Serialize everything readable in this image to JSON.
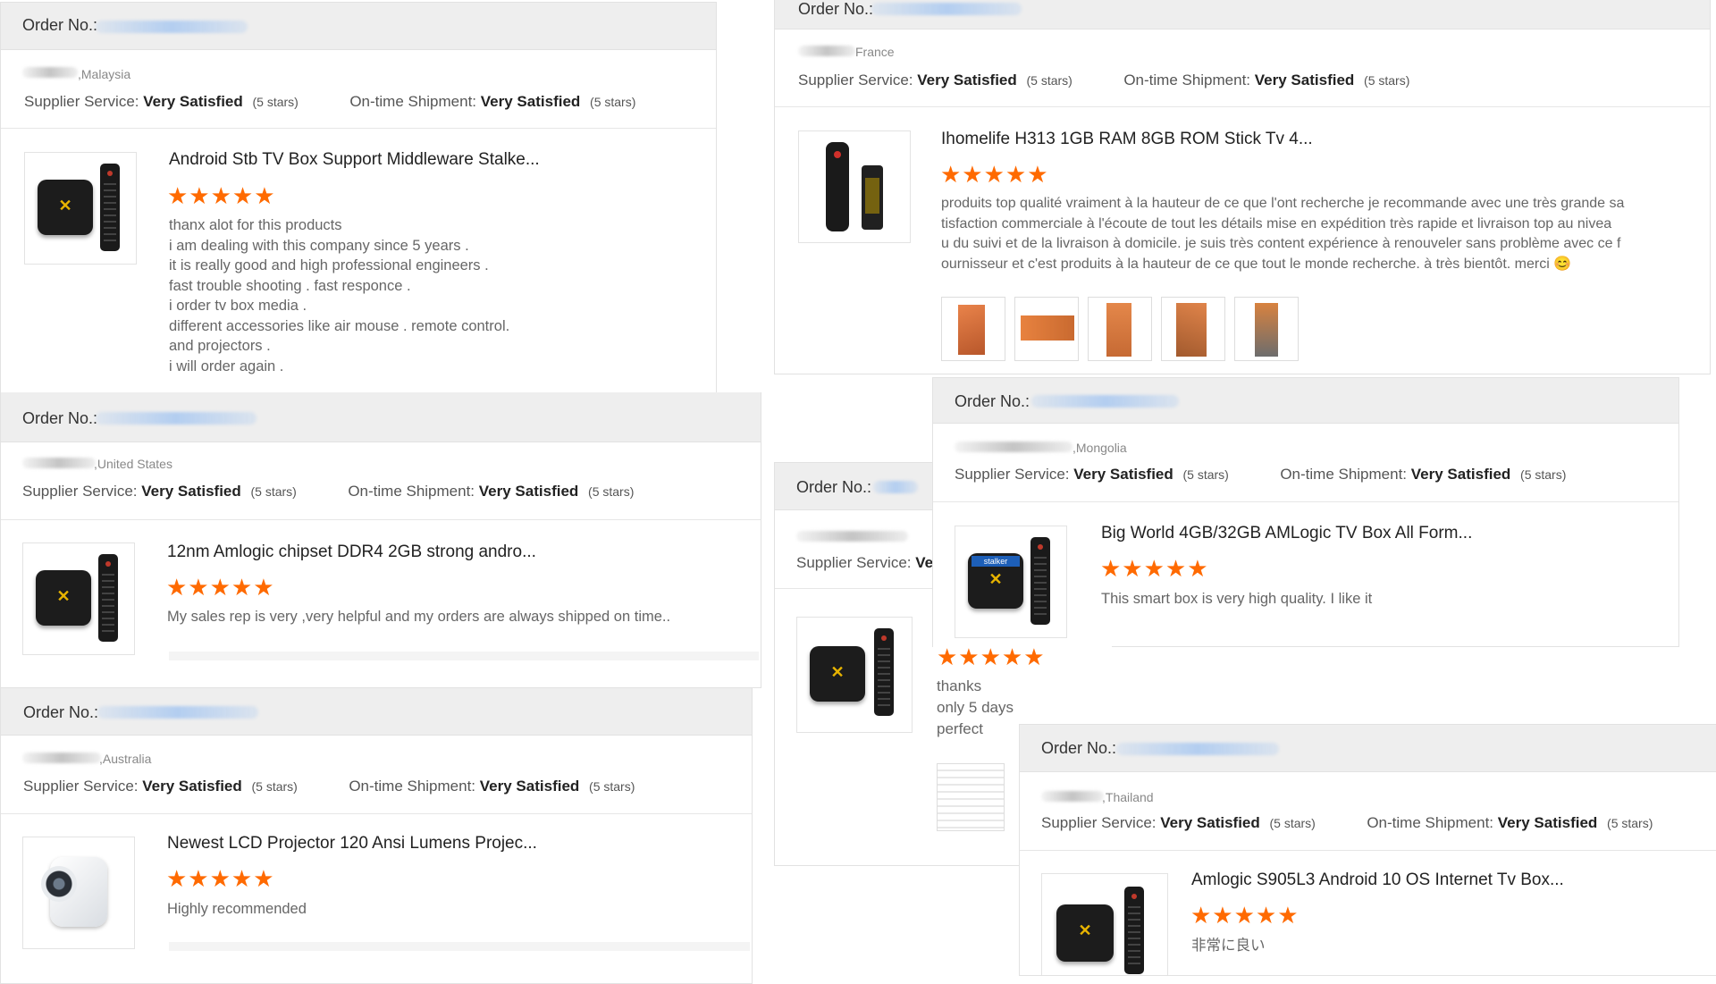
{
  "labels": {
    "order_no": "Order No.:",
    "supplier_service": "Supplier Service:",
    "on_time_shipment": "On-time Shipment:",
    "very_satisfied": "Very Satisfied",
    "five_stars": "(5 stars)",
    "supplier_service_cut": "Supplier Service:",
    "very_cut": "Ve"
  },
  "rating_stars": "★★★★★",
  "accent_color": "#ff6a00",
  "reviews": [
    {
      "country": ",Malaysia",
      "product_title": "Android Stb TV Box Support Middleware Stalke...",
      "rating": 5,
      "text_lines": [
        "thanx alot for this products",
        "i am dealing with this company since 5 years .",
        "it is really good and high professional engineers .",
        "fast trouble shooting . fast responce .",
        "i order tv box media .",
        "different accessories like air mouse . remote control.",
        "and projectors .",
        "i will order again ."
      ]
    },
    {
      "country": ",United States",
      "product_title": "12nm Amlogic chipset DDR4 2GB strong andro...",
      "rating": 5,
      "text_lines": [
        "My sales rep is very ,very helpful and my orders are always shipped on time.."
      ]
    },
    {
      "country": ",Australia",
      "product_title": "Newest LCD Projector 120 Ansi Lumens Projec...",
      "rating": 5,
      "text_lines": [
        "Highly recommended"
      ]
    },
    {
      "country": "France",
      "product_title": "Ihomelife H313 1GB RAM 8GB ROM Stick Tv 4...",
      "rating": 5,
      "text_lines": [
        "produits top qualité vraiment à la hauteur de ce que l'ont recherche je recommande avec une très grande sa",
        "tisfaction commerciale à l'écoute de tout les détails mise en expédition très rapide et livraison top au nivea",
        "u du suivi et de la livraison à domicile. je suis très content expérience à renouveler sans problème avec ce f",
        "ournisseur et c'est produits à la hauteur de ce que tout le monde recherche. à très bientôt. merci 😊"
      ]
    },
    {
      "country": ",Mongolia",
      "product_title": "Big World 4GB/32GB AMLogic TV Box All Form...",
      "rating": 5,
      "text_lines": [
        "This smart box is very high quality. I like it"
      ],
      "badge": "stalker"
    },
    {
      "country": "",
      "product_title": "",
      "rating": 5,
      "text_lines": [
        "thanks",
        "only 5 days",
        "perfect"
      ]
    },
    {
      "country": ",Thailand",
      "product_title": "Amlogic S905L3 Android 10 OS Internet Tv Box...",
      "rating": 5,
      "text_lines": [
        "非常に良い"
      ]
    }
  ]
}
